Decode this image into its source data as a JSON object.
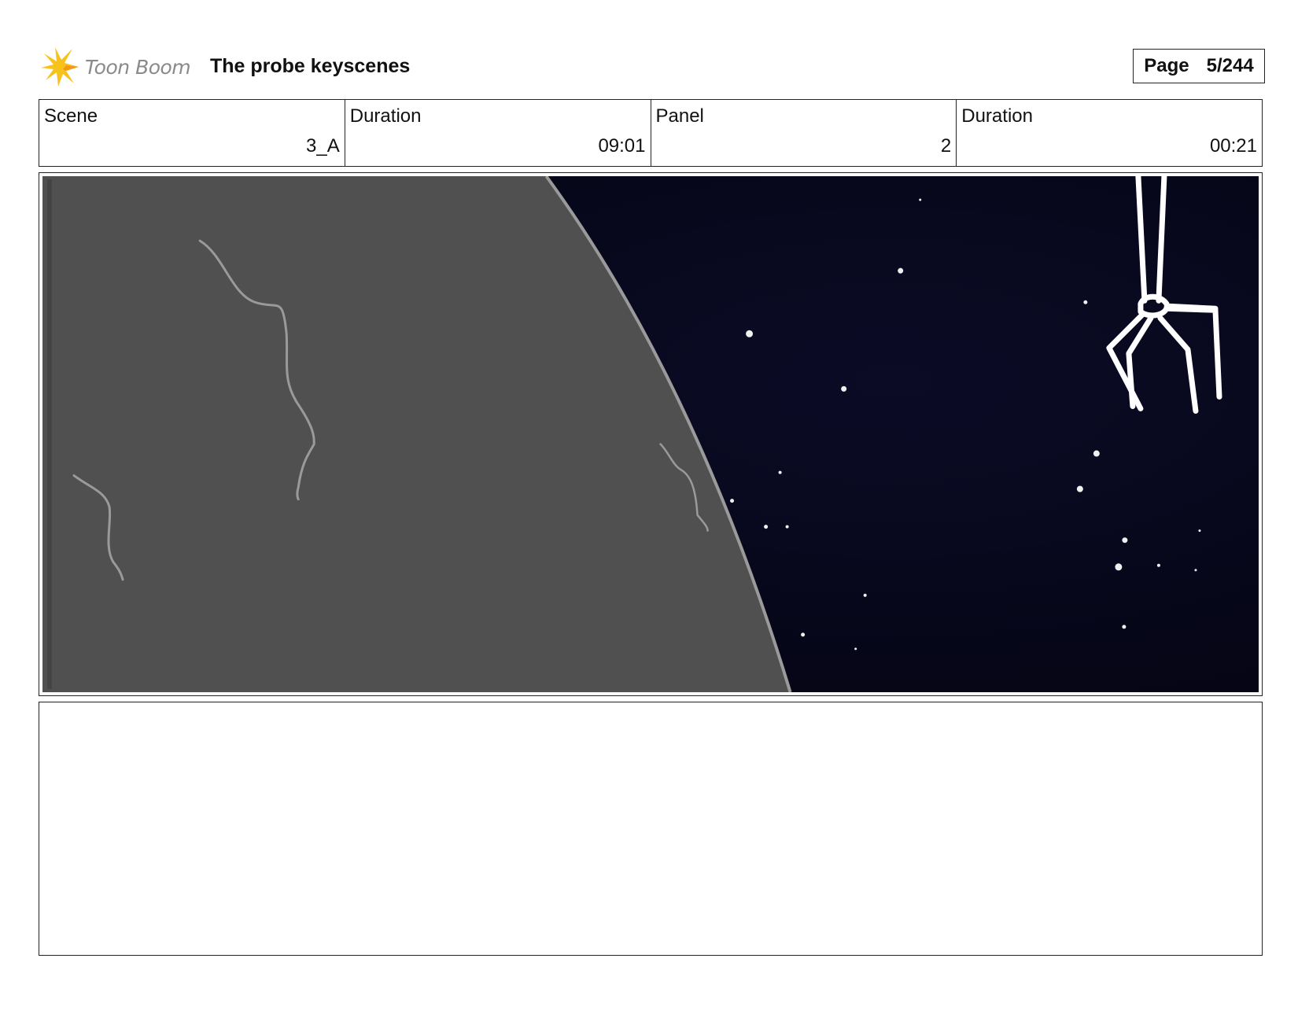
{
  "header": {
    "brand": "Toon Boom",
    "title": "The probe keyscenes",
    "page_label": "Page",
    "page_value": "5/244"
  },
  "info": [
    {
      "label": "Scene",
      "value": "3_A"
    },
    {
      "label": "Duration",
      "value": "09:01"
    },
    {
      "label": "Panel",
      "value": "2"
    },
    {
      "label": "Duration",
      "value": "00:21"
    }
  ],
  "panel": {
    "icon": "storyboard-image",
    "planet_color": "#505050",
    "space_color": "#06061a",
    "rim_color": "#9a9a9a",
    "probe_color": "#ffffff"
  },
  "notes": {
    "text": ""
  }
}
